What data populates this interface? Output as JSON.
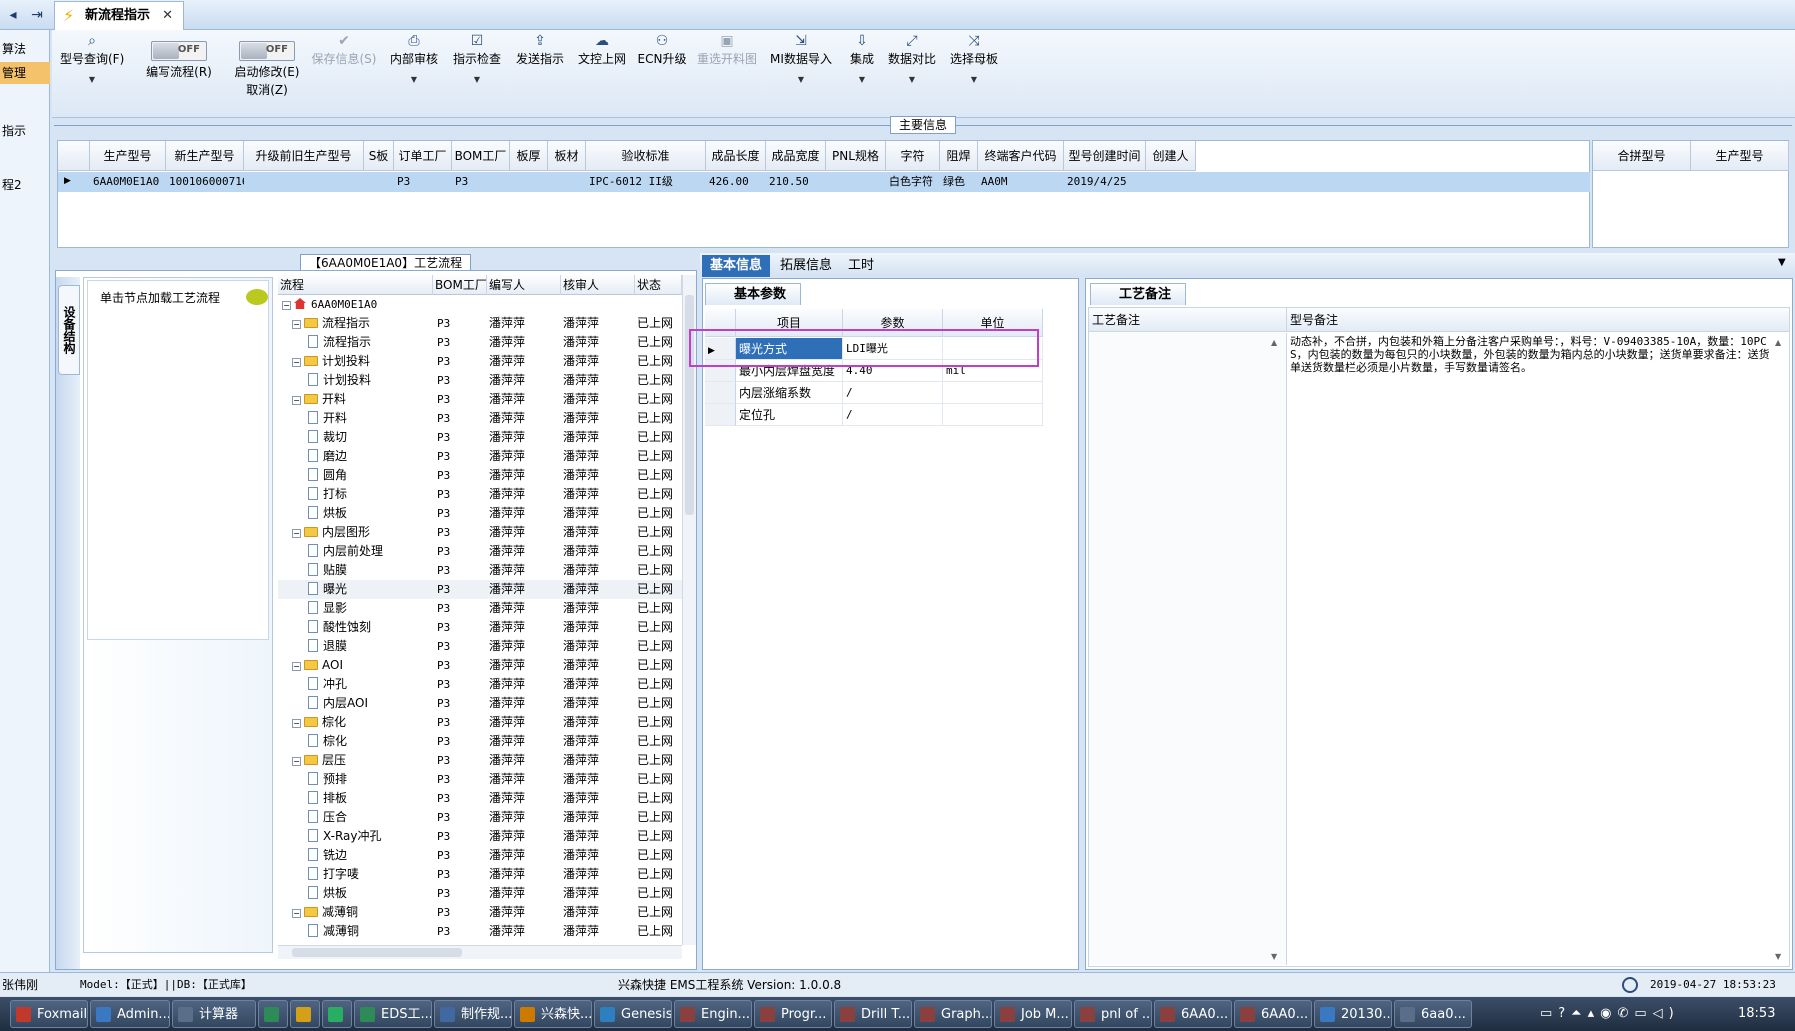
{
  "tabbar": {
    "doc_tab": "新流程指示"
  },
  "left_strip": [
    "算法",
    "管理",
    "",
    "指示",
    "",
    "程2"
  ],
  "toolbar": {
    "model_query": "型号查询(F)",
    "edit_flow": "编写流程(R)",
    "enable_edit": "启动修改(E)",
    "enable_edit_sub": "取消(Z)",
    "toggle_off": "OFF",
    "save": "保存信息(S)",
    "internal_review": "内部审核",
    "instr_check": "指示检查",
    "send_instr": "发送指示",
    "doc_upload": "文控上网",
    "ecn_upgrade": "ECN升级",
    "reselect_material": "重选开料图",
    "mi_import": "MI数据导入",
    "integrate": "集成",
    "data_compare": "数据对比",
    "select_master": "选择母板"
  },
  "main_info": {
    "title": "主要信息",
    "columns": [
      "生产型号",
      "新生产型号",
      "升级前旧生产型号",
      "S板",
      "订单工厂",
      "BOM工厂",
      "板厚",
      "板材",
      "验收标准",
      "成品长度",
      "成品宽度",
      "PNL规格",
      "字符",
      "阻焊",
      "终端客户代码",
      "型号创建时间",
      "创建人"
    ],
    "row": [
      "6AA0M0E1A0",
      "10010600071648",
      "",
      "",
      "P3",
      "P3",
      "",
      "",
      "IPC-6012 II级",
      "426.00",
      "210.50",
      "",
      "白色字符",
      "绿色",
      "AA0M",
      "2019/4/25",
      ""
    ]
  },
  "merge_grid": {
    "columns": [
      "合拼型号",
      "生产型号"
    ]
  },
  "process": {
    "title": "【6AA0M0E1A0】工艺流程",
    "side_tab": "设备结构",
    "load_hint": "单击节点加载工艺流程",
    "columns": [
      "流程",
      "BOM工厂",
      "编写人",
      "核审人",
      "状态"
    ],
    "root": "6AA0M0E1A0",
    "rows": [
      {
        "name": "流程指示",
        "lvl": 1,
        "type": "folder",
        "bom": "P3",
        "writer": "潘萍萍",
        "reviewer": "潘萍萍",
        "status": "已上网"
      },
      {
        "name": "流程指示",
        "lvl": 2,
        "type": "doc",
        "bom": "P3",
        "writer": "潘萍萍",
        "reviewer": "潘萍萍",
        "status": "已上网"
      },
      {
        "name": "计划投料",
        "lvl": 1,
        "type": "folder",
        "bom": "P3",
        "writer": "潘萍萍",
        "reviewer": "潘萍萍",
        "status": "已上网"
      },
      {
        "name": "计划投料",
        "lvl": 2,
        "type": "doc",
        "bom": "P3",
        "writer": "潘萍萍",
        "reviewer": "潘萍萍",
        "status": "已上网"
      },
      {
        "name": "开料",
        "lvl": 1,
        "type": "folder",
        "bom": "P3",
        "writer": "潘萍萍",
        "reviewer": "潘萍萍",
        "status": "已上网"
      },
      {
        "name": "开料",
        "lvl": 2,
        "type": "doc",
        "bom": "P3",
        "writer": "潘萍萍",
        "reviewer": "潘萍萍",
        "status": "已上网"
      },
      {
        "name": "裁切",
        "lvl": 2,
        "type": "doc",
        "bom": "P3",
        "writer": "潘萍萍",
        "reviewer": "潘萍萍",
        "status": "已上网"
      },
      {
        "name": "磨边",
        "lvl": 2,
        "type": "doc",
        "bom": "P3",
        "writer": "潘萍萍",
        "reviewer": "潘萍萍",
        "status": "已上网"
      },
      {
        "name": "圆角",
        "lvl": 2,
        "type": "doc",
        "bom": "P3",
        "writer": "潘萍萍",
        "reviewer": "潘萍萍",
        "status": "已上网"
      },
      {
        "name": "打标",
        "lvl": 2,
        "type": "doc",
        "bom": "P3",
        "writer": "潘萍萍",
        "reviewer": "潘萍萍",
        "status": "已上网"
      },
      {
        "name": "烘板",
        "lvl": 2,
        "type": "doc",
        "bom": "P3",
        "writer": "潘萍萍",
        "reviewer": "潘萍萍",
        "status": "已上网"
      },
      {
        "name": "内层图形",
        "lvl": 1,
        "type": "folder",
        "bom": "P3",
        "writer": "潘萍萍",
        "reviewer": "潘萍萍",
        "status": "已上网"
      },
      {
        "name": "内层前处理",
        "lvl": 2,
        "type": "doc",
        "bom": "P3",
        "writer": "潘萍萍",
        "reviewer": "潘萍萍",
        "status": "已上网"
      },
      {
        "name": "贴膜",
        "lvl": 2,
        "type": "doc",
        "bom": "P3",
        "writer": "潘萍萍",
        "reviewer": "潘萍萍",
        "status": "已上网"
      },
      {
        "name": "曝光",
        "lvl": 2,
        "type": "doc",
        "bom": "P3",
        "writer": "潘萍萍",
        "reviewer": "潘萍萍",
        "status": "已上网"
      },
      {
        "name": "显影",
        "lvl": 2,
        "type": "doc",
        "bom": "P3",
        "writer": "潘萍萍",
        "reviewer": "潘萍萍",
        "status": "已上网"
      },
      {
        "name": "酸性蚀刻",
        "lvl": 2,
        "type": "doc",
        "bom": "P3",
        "writer": "潘萍萍",
        "reviewer": "潘萍萍",
        "status": "已上网"
      },
      {
        "name": "退膜",
        "lvl": 2,
        "type": "doc",
        "bom": "P3",
        "writer": "潘萍萍",
        "reviewer": "潘萍萍",
        "status": "已上网"
      },
      {
        "name": "AOI",
        "lvl": 1,
        "type": "folder",
        "bom": "P3",
        "writer": "潘萍萍",
        "reviewer": "潘萍萍",
        "status": "已上网"
      },
      {
        "name": "冲孔",
        "lvl": 2,
        "type": "doc",
        "bom": "P3",
        "writer": "潘萍萍",
        "reviewer": "潘萍萍",
        "status": "已上网"
      },
      {
        "name": "内层AOI",
        "lvl": 2,
        "type": "doc",
        "bom": "P3",
        "writer": "潘萍萍",
        "reviewer": "潘萍萍",
        "status": "已上网"
      },
      {
        "name": "棕化",
        "lvl": 1,
        "type": "folder",
        "bom": "P3",
        "writer": "潘萍萍",
        "reviewer": "潘萍萍",
        "status": "已上网"
      },
      {
        "name": "棕化",
        "lvl": 2,
        "type": "doc",
        "bom": "P3",
        "writer": "潘萍萍",
        "reviewer": "潘萍萍",
        "status": "已上网"
      },
      {
        "name": "层压",
        "lvl": 1,
        "type": "folder",
        "bom": "P3",
        "writer": "潘萍萍",
        "reviewer": "潘萍萍",
        "status": "已上网"
      },
      {
        "name": "预排",
        "lvl": 2,
        "type": "doc",
        "bom": "P3",
        "writer": "潘萍萍",
        "reviewer": "潘萍萍",
        "status": "已上网"
      },
      {
        "name": "排板",
        "lvl": 2,
        "type": "doc",
        "bom": "P3",
        "writer": "潘萍萍",
        "reviewer": "潘萍萍",
        "status": "已上网"
      },
      {
        "name": "压合",
        "lvl": 2,
        "type": "doc",
        "bom": "P3",
        "writer": "潘萍萍",
        "reviewer": "潘萍萍",
        "status": "已上网"
      },
      {
        "name": "X-Ray冲孔",
        "lvl": 2,
        "type": "doc",
        "bom": "P3",
        "writer": "潘萍萍",
        "reviewer": "潘萍萍",
        "status": "已上网"
      },
      {
        "name": "铣边",
        "lvl": 2,
        "type": "doc",
        "bom": "P3",
        "writer": "潘萍萍",
        "reviewer": "潘萍萍",
        "status": "已上网"
      },
      {
        "name": "打字唛",
        "lvl": 2,
        "type": "doc",
        "bom": "P3",
        "writer": "潘萍萍",
        "reviewer": "潘萍萍",
        "status": "已上网"
      },
      {
        "name": "烘板",
        "lvl": 2,
        "type": "doc",
        "bom": "P3",
        "writer": "潘萍萍",
        "reviewer": "潘萍萍",
        "status": "已上网"
      },
      {
        "name": "减薄铜",
        "lvl": 1,
        "type": "folder",
        "bom": "P3",
        "writer": "潘萍萍",
        "reviewer": "潘萍萍",
        "status": "已上网"
      },
      {
        "name": "减薄铜",
        "lvl": 2,
        "type": "doc",
        "bom": "P3",
        "writer": "潘萍萍",
        "reviewer": "潘萍萍",
        "status": "已上网"
      }
    ]
  },
  "detail_tabs": [
    "基本信息",
    "拓展信息",
    "工时"
  ],
  "basic_params": {
    "title": "基本参数",
    "columns": [
      "项目",
      "参数",
      "单位"
    ],
    "rows": [
      {
        "item": "曝光方式",
        "value": "LDI曝光",
        "unit": ""
      },
      {
        "item": "最小内层焊盘宽度",
        "value": "4.40",
        "unit": "mil"
      },
      {
        "item": "内层涨缩系数",
        "value": "/",
        "unit": ""
      },
      {
        "item": "定位孔",
        "value": "/",
        "unit": ""
      }
    ]
  },
  "remarks": {
    "tab": "工艺备注",
    "col1": "工艺备注",
    "col2": "型号备注",
    "model_remark": "动态补，不合拼，内包装和外箱上分备注客户采购单号：，料号：V-09403385-10A，数量：10PCS，内包装的数量为每包只的小块数量，外包装的数量为箱内总的小块数量；送货单要求备注：送货单送货数量栏必须是小片数量，手写数量请签名。"
  },
  "status": {
    "user": "张伟刚",
    "model": "Model:【正式】||DB:【正式库】",
    "app": "兴森快捷 EMS工程系统 Version: 1.0.0.8",
    "datetime": "2019-04-27 18:53:23"
  },
  "taskbar": {
    "items": [
      "Foxmail",
      "Admin...",
      "计算器",
      "",
      "",
      "",
      "EDS工...",
      "制作规...",
      "兴森快...",
      "Genesis",
      "Engin...",
      "Progr...",
      "Drill T...",
      "Graph...",
      "Job M...",
      "pnl of ...",
      "6AA0...",
      "6AA0...",
      "20130...",
      "6aa0..."
    ],
    "clock": "18:53"
  },
  "colors": {
    "accent": "#2f6fb8",
    "selected_row": "#bcd7f2",
    "highlight_box": "#c13ec9"
  }
}
